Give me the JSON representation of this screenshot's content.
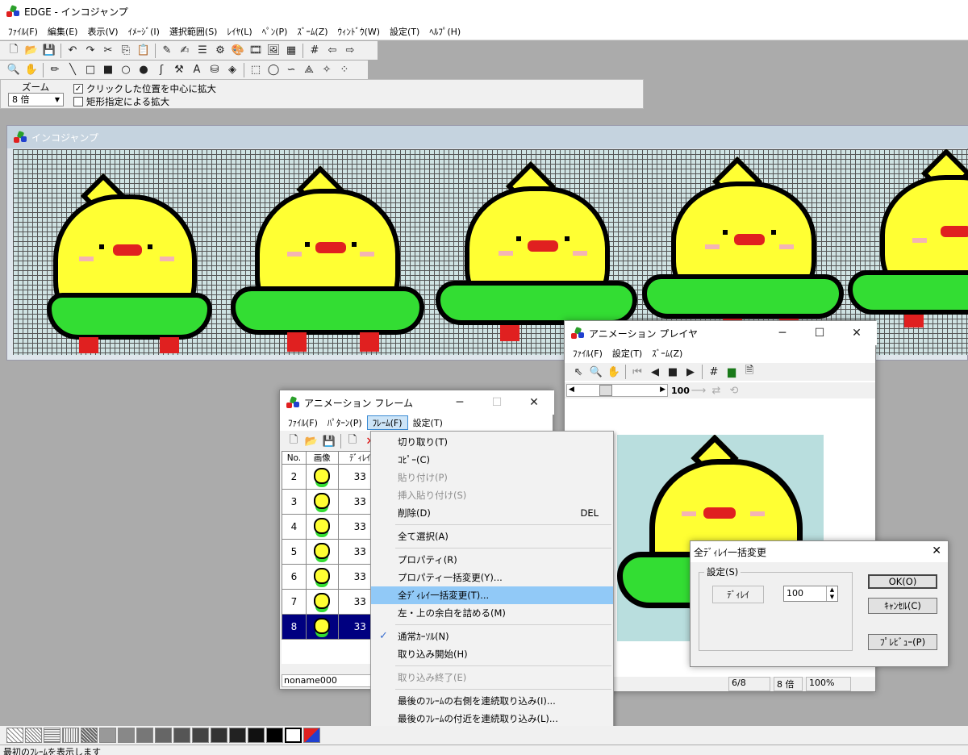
{
  "app": {
    "title": "EDGE - インコジャンプ",
    "menu": [
      "ﾌｧｲﾙ(F)",
      "編集(E)",
      "表示(V)",
      "ｲﾒｰｼﾞ(I)",
      "選択範囲(S)",
      "ﾚｲﾔ(L)",
      "ﾍﾟﾝ(P)",
      "ｽﾞｰﾑ(Z)",
      "ｳｨﾝﾄﾞｳ(W)",
      "設定(T)",
      "ﾍﾙﾌﾟ(H)"
    ]
  },
  "zoom_panel": {
    "label": "ズーム",
    "value": "8 倍",
    "check1_label": "クリックした位置を中心に拡大",
    "check1_checked": true,
    "check2_label": "矩形指定による拡大",
    "check2_checked": false
  },
  "doc_window": {
    "title": "インコジャンプ"
  },
  "frames_window": {
    "title": "アニメーション フレーム",
    "menu": [
      "ﾌｧｲﾙ(F)",
      "ﾊﾟﾀｰﾝ(P)",
      "ﾌﾚｰﾑ(F)",
      "設定(T)"
    ],
    "columns": [
      "No.",
      "画像",
      "ﾃﾞｨﾚｲ"
    ],
    "rows": [
      {
        "no": "2",
        "delay": "33"
      },
      {
        "no": "3",
        "delay": "33"
      },
      {
        "no": "4",
        "delay": "33"
      },
      {
        "no": "5",
        "delay": "33"
      },
      {
        "no": "6",
        "delay": "33"
      },
      {
        "no": "7",
        "delay": "33"
      },
      {
        "no": "8",
        "delay": "33"
      }
    ],
    "selected_row": "8",
    "status": "noname000"
  },
  "frame_menu": {
    "items": [
      {
        "label": "切り取り(T)",
        "shortcut": "",
        "disabled": false
      },
      {
        "label": "ｺﾋﾟｰ(C)",
        "shortcut": "",
        "disabled": false
      },
      {
        "label": "貼り付け(P)",
        "shortcut": "",
        "disabled": true
      },
      {
        "label": "挿入貼り付け(S)",
        "shortcut": "",
        "disabled": true
      },
      {
        "label": "削除(D)",
        "shortcut": "DEL",
        "disabled": false
      },
      {
        "label": "全て選択(A)",
        "shortcut": "",
        "disabled": false
      },
      {
        "label": "プロパティ(R)",
        "shortcut": "",
        "disabled": false
      },
      {
        "label": "プロパティ一括変更(Y)...",
        "shortcut": "",
        "disabled": false
      },
      {
        "label": "全ﾃﾞｨﾚｲ一括変更(T)...",
        "shortcut": "",
        "disabled": false
      },
      {
        "label": "左・上の余白を詰める(M)",
        "shortcut": "",
        "disabled": false
      },
      {
        "label": "通常ｶｰｿﾙ(N)",
        "shortcut": "",
        "disabled": false
      },
      {
        "label": "取り込み開始(H)",
        "shortcut": "",
        "disabled": false
      },
      {
        "label": "取り込み終了(E)",
        "shortcut": "",
        "disabled": true
      },
      {
        "label": "最後のﾌﾚｰﾑの右側を連続取り込み(I)...",
        "shortcut": "",
        "disabled": false
      },
      {
        "label": "最後のﾌﾚｰﾑの付近を連続取り込み(L)...",
        "shortcut": "",
        "disabled": false
      }
    ],
    "highlighted": "全ﾃﾞｨﾚｲ一括変更(T)...",
    "checked": "通常ｶｰｿﾙ(N)"
  },
  "player_window": {
    "title": "アニメーション プレイヤ",
    "menu": [
      "ﾌｧｲﾙ(F)",
      "設定(T)",
      "ｽﾞｰﾑ(Z)"
    ],
    "speed": "100",
    "status": [
      "6/8",
      "8 倍",
      "100%"
    ]
  },
  "delay_dialog": {
    "title": "全ﾃﾞｨﾚｲ一括変更",
    "group_label": "設定(S)",
    "field_label": "ﾃﾞｨﾚｲ",
    "value": "100",
    "ok": "OK(O)",
    "cancel": "ｷｬﾝｾﾙ(C)",
    "preview": "ﾌﾟﾚﾋﾞｭｰ(P)"
  },
  "status_bar": "最初のﾌﾚｰﾑを表示します",
  "colors": {
    "highlight": "#91c9f7",
    "selected_row": "#000080",
    "bird_yellow": "#ffff33",
    "bird_green": "#33dd33",
    "beak_red": "#e02020"
  }
}
